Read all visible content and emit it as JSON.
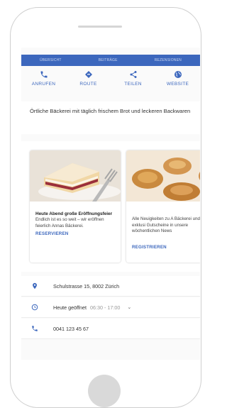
{
  "tabs": [
    "ÜBERSICHT",
    "BEITRÄGE",
    "REZENSIONEN"
  ],
  "actions": [
    {
      "label": "ANRUFEN",
      "icon": "phone-icon"
    },
    {
      "label": "ROUTE",
      "icon": "directions-icon"
    },
    {
      "label": "TEILEN",
      "icon": "share-icon"
    },
    {
      "label": "WEBSITE",
      "icon": "globe-icon"
    }
  ],
  "description": "Örtliche Bäckerei mit täglich frischem Brot und leckeren Backwaren",
  "posts": [
    {
      "title": "Heute Abend große Eröffnungsfeier",
      "body": "Endlich ist es so weit – wir eröffnen feierlich Annas Bäckerei.",
      "cta": "RESERVIEREN"
    },
    {
      "title": "",
      "body": "Alle Neuigkeiten zu A Bäckerei und exklusi Gutscheine in unsere wöchentlichen News",
      "cta": "REGISTRIEREN"
    }
  ],
  "info": {
    "address": "Schulstrasse 15, 8002 Zürich",
    "hours_status": "Heute geöffnet",
    "hours": "06:30 - 17:00",
    "phone": "0041 123 45 67"
  },
  "colors": {
    "accent": "#3c67bd"
  }
}
